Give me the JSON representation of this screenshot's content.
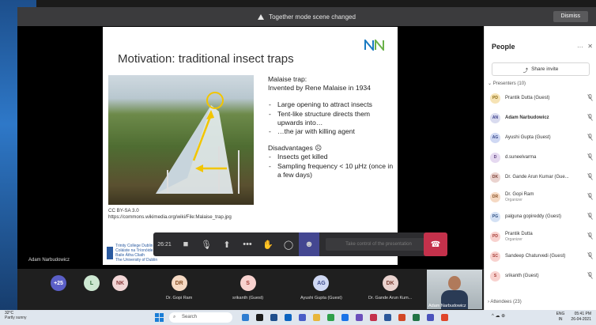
{
  "banner": {
    "text": "Together mode scene changed",
    "dismiss": "Dismiss"
  },
  "stage": {
    "presenter": "Adam Narbudowicz"
  },
  "slide": {
    "title": "Motivation: traditional insect traps",
    "lines": [
      {
        "text": "Malaise trap:",
        "type": "plain"
      },
      {
        "text": "Invented by Rene Malaise in 1934",
        "type": "plain"
      },
      {
        "text": "",
        "type": "gap"
      },
      {
        "text": "Large opening to attract insects",
        "type": "li"
      },
      {
        "text": "Tent-like structure directs them upwards into…",
        "type": "li"
      },
      {
        "text": "…the jar with killing agent",
        "type": "li"
      },
      {
        "text": "",
        "type": "gap"
      },
      {
        "text": "Disadvantages ☹",
        "type": "plain"
      },
      {
        "text": "Insects get killed",
        "type": "li"
      },
      {
        "text": "Sampling frequency < 10 µHz (once in a few days)",
        "type": "li"
      }
    ],
    "credit_1": "CC BY-SA 3.0",
    "credit_2": "https://commons.wikimedia.org/wiki/File:Malaise_trap.jpg",
    "logo_1": "Trinity College Dublin",
    "logo_2": "Coláiste na Tríonóide, Baile Átha Cliath",
    "logo_3": "The University of Dublin"
  },
  "toolbar": {
    "time": "26:21",
    "take_control": "Take control of the presentation",
    "buttons": [
      "camera-icon",
      "mic-off-icon",
      "share-icon",
      "more-icon",
      "raise-hand-icon",
      "chat-icon",
      "people-icon"
    ]
  },
  "strip": {
    "participants": [
      {
        "initials": "+25",
        "name": "",
        "color": "#5b5fc7",
        "text": "#fff"
      },
      {
        "initials": "L",
        "name": "",
        "color": "#cde8d2",
        "text": "#2f6a3a"
      },
      {
        "initials": "NK",
        "name": "",
        "color": "#f2d6d6",
        "text": "#8a3b3b"
      },
      {
        "initials": "DR",
        "name": "Dr. Gopi Ram",
        "color": "#f5d9c3",
        "text": "#8a5227"
      },
      {
        "initials": "S",
        "name": "srikanth (Guest)",
        "color": "#f8d2cf",
        "text": "#a33a33"
      },
      {
        "initials": "AG",
        "name": "Ayushi Gupta (Guest)",
        "color": "#cfd8f3",
        "text": "#3b4a8a"
      },
      {
        "initials": "DK",
        "name": "Dr. Gande Arun Kum...",
        "color": "#ead3cf",
        "text": "#7b3f33"
      }
    ],
    "video_name": "Adam Narbudowicz"
  },
  "people": {
    "title": "People",
    "share": "Share invite",
    "presenters_header": "Presenters (10)",
    "attendees_header": "Attendees (23)",
    "rows": [
      {
        "initials": "PD",
        "name": "Prantik Dutta (Guest)",
        "role": "",
        "color": "#f6e3b5",
        "text": "#8a6a10",
        "bold": false
      },
      {
        "initials": "AN",
        "name": "Adam Narbudowicz",
        "role": "",
        "color": "#d9dbef",
        "text": "#3b3f8a",
        "bold": true
      },
      {
        "initials": "AG",
        "name": "Ayushi Gupta (Guest)",
        "role": "",
        "color": "#cfd8f3",
        "text": "#3b4a8a",
        "bold": false
      },
      {
        "initials": "D",
        "name": "d.suneelvarma",
        "role": "",
        "color": "#e5d9f0",
        "text": "#5b3d7a",
        "bold": false
      },
      {
        "initials": "DK",
        "name": "Dr. Gande Arun Kumar (Gue...",
        "role": "",
        "color": "#ead3cf",
        "text": "#7b3f33",
        "bold": false
      },
      {
        "initials": "DR",
        "name": "Dr. Gopi Ram",
        "role": "Organizer",
        "color": "#f5d9c3",
        "text": "#8a5227",
        "bold": false
      },
      {
        "initials": "PG",
        "name": "palguna gopireddy (Guest)",
        "role": "",
        "color": "#d4e1f4",
        "text": "#2f4f80",
        "bold": false
      },
      {
        "initials": "PD",
        "name": "Prantik Dutta",
        "role": "Organizer",
        "color": "#f8d2cf",
        "text": "#a33a33",
        "bold": false
      },
      {
        "initials": "SC",
        "name": "Sandeep Chaturvedi (Guest)",
        "role": "",
        "color": "#f8d2cf",
        "text": "#a33a33",
        "bold": false
      },
      {
        "initials": "S",
        "name": "srikanth (Guest)",
        "role": "",
        "color": "#f8d2cf",
        "text": "#a33a33",
        "bold": false
      }
    ]
  },
  "taskbar": {
    "temp": "32°C",
    "weather": "Partly sunny",
    "search": "Search",
    "lang_1": "ENG",
    "lang_2": "IN",
    "time": "05:41 PM",
    "date": "26-04-2021"
  }
}
